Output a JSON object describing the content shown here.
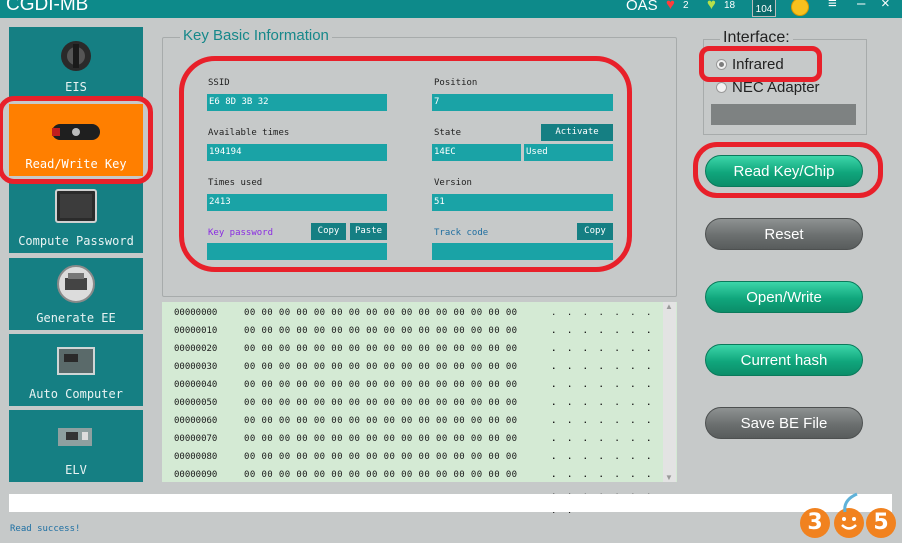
{
  "app": {
    "title": "CGDI-MB",
    "oas": "OAS",
    "hearts": "2",
    "diamonds": "18",
    "box_value": "104"
  },
  "sidebar": {
    "items": [
      {
        "label": "EIS",
        "icon": "ignition-lock-icon"
      },
      {
        "label": "Read/Write Key",
        "icon": "car-key-icon",
        "active": true
      },
      {
        "label": "Compute Password",
        "icon": "computer-screen-icon"
      },
      {
        "label": "Generate EE",
        "icon": "printer-icon"
      },
      {
        "label": "Auto Computer",
        "icon": "ecu-icon"
      },
      {
        "label": "ELV",
        "icon": "steering-lock-module-icon"
      }
    ]
  },
  "key_info": {
    "legend": "Key Basic Information",
    "ssid_label": "SSID",
    "ssid": "E6 8D 3B 32",
    "position_label": "Position",
    "position": "7",
    "available_label": "Available times",
    "available": "194194",
    "state_label": "State",
    "state": "14EC",
    "state_status": "Used",
    "activate_label": "Activate",
    "used_label": "Times used",
    "used": "2413",
    "version_label": "Version",
    "version": "51",
    "keypass_label": "Key password",
    "keypass": "",
    "copy_label": "Copy",
    "paste_label": "Paste",
    "track_label": "Track code",
    "track": "",
    "copy2_label": "Copy"
  },
  "interface": {
    "legend": "Interface:",
    "option_infrared": "Infrared",
    "option_nec": "NEC Adapter",
    "selected": "Infrared"
  },
  "actions": {
    "read": "Read Key/Chip",
    "reset": "Reset",
    "open_write": "Open/Write",
    "current_hash": "Current hash",
    "save_be": "Save BE File"
  },
  "hex_dump": {
    "rows": [
      {
        "addr": "00000000",
        "bytes": "00 00 00 00 00 00 00 00 00 00 00 00 00 00 00 00",
        "ascii": ". . . . . . . . . . . . . . . ."
      },
      {
        "addr": "00000010",
        "bytes": "00 00 00 00 00 00 00 00 00 00 00 00 00 00 00 00",
        "ascii": ". . . . . . . . . . . . . . . ."
      },
      {
        "addr": "00000020",
        "bytes": "00 00 00 00 00 00 00 00 00 00 00 00 00 00 00 00",
        "ascii": ". . . . . . . . . . . . . . . ."
      },
      {
        "addr": "00000030",
        "bytes": "00 00 00 00 00 00 00 00 00 00 00 00 00 00 00 00",
        "ascii": ". . . . . . . . . . . . . . . ."
      },
      {
        "addr": "00000040",
        "bytes": "00 00 00 00 00 00 00 00 00 00 00 00 00 00 00 00",
        "ascii": ". . . . . . . . . . . . . . . ."
      },
      {
        "addr": "00000050",
        "bytes": "00 00 00 00 00 00 00 00 00 00 00 00 00 00 00 00",
        "ascii": ". . . . . . . . . . . . . . . ."
      },
      {
        "addr": "00000060",
        "bytes": "00 00 00 00 00 00 00 00 00 00 00 00 00 00 00 00",
        "ascii": ". . . . . . . . . . . . . . . ."
      },
      {
        "addr": "00000070",
        "bytes": "00 00 00 00 00 00 00 00 00 00 00 00 00 00 00 00",
        "ascii": ". . . . . . . . . . . . . . . ."
      },
      {
        "addr": "00000080",
        "bytes": "00 00 00 00 00 00 00 00 00 00 00 00 00 00 00 00",
        "ascii": ". . . . . . . . . . . . . . . ."
      },
      {
        "addr": "00000090",
        "bytes": "00 00 00 00 00 00 00 00 00 00 00 00 00 00 00 00",
        "ascii": ". . . . . . . . . . . . . . . ."
      }
    ]
  },
  "status": {
    "message": "Read success!"
  },
  "watermark": {
    "d1": "3",
    "d3": "5"
  },
  "colors": {
    "accent_teal": "#157f83",
    "active_orange": "#ff7f00",
    "highlight_red": "#e8202a",
    "field_teal": "#1aa3a6"
  }
}
